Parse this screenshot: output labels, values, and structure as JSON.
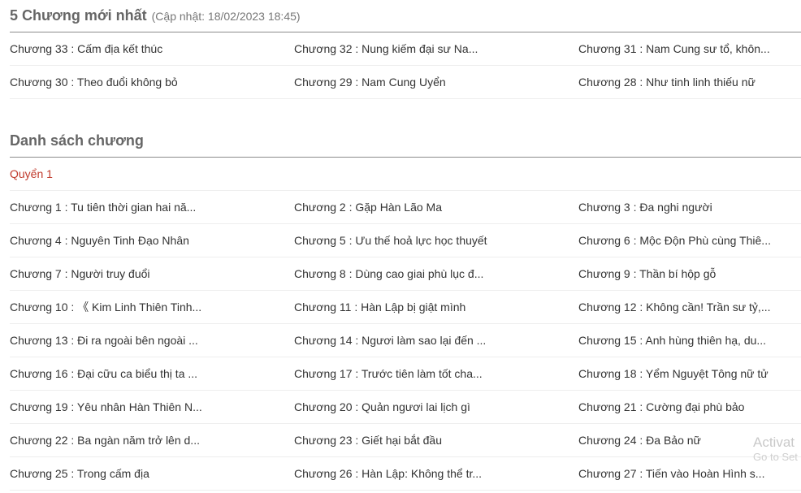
{
  "latest": {
    "title": "5 Chương mới nhất",
    "updated": "(Cập nhật: 18/02/2023 18:45)",
    "rows": [
      [
        "Chương 33 : Cấm địa kết thúc",
        "Chương 32 : Nung kiếm đại sư Na...",
        "Chương 31 : Nam Cung sư tổ, khôn..."
      ],
      [
        "Chương 30 : Theo đuổi không bỏ",
        "Chương 29 : Nam Cung Uyển",
        "Chương 28 : Như tinh linh thiếu nữ"
      ]
    ]
  },
  "list": {
    "title": "Danh sách chương",
    "volume": "Quyển 1",
    "rows": [
      [
        "Chương 1 : Tu tiên thời gian hai nă...",
        "Chương 2 : Gặp Hàn Lão Ma",
        "Chương 3 : Đa nghi người"
      ],
      [
        "Chương 4 : Nguyên Tinh Đạo Nhân",
        "Chương 5 : Ưu thế hoả lực học thuyết",
        "Chương 6 : Mộc Độn Phù cùng Thiê..."
      ],
      [
        "Chương 7 : Người truy đuổi",
        "Chương 8 : Dùng cao giai phù lục đ...",
        "Chương 9 : Thần bí hộp gỗ"
      ],
      [
        "Chương 10 : 《 Kim Linh Thiên Tinh...",
        "Chương 11 : Hàn Lập bị giật mình",
        "Chương 12 : Không cần! Trần sư tỷ,..."
      ],
      [
        "Chương 13 : Đi ra ngoài bên ngoài ...",
        "Chương 14 : Ngươi làm sao lại đến ...",
        "Chương 15 : Anh hùng thiên hạ, du..."
      ],
      [
        "Chương 16 : Đại cữu ca biểu thị ta ...",
        "Chương 17 : Trước tiên làm tốt cha...",
        "Chương 18 : Yểm Nguyệt Tông nữ tử"
      ],
      [
        "Chương 19 : Yêu nhân Hàn Thiên N...",
        "Chương 20 : Quản ngươi lai lịch gì",
        "Chương 21 : Cường đại phù bảo"
      ],
      [
        "Chương 22 : Ba ngàn năm trở lên d...",
        "Chương 23 : Giết hại bắt đầu",
        "Chương 24 : Đa Bảo nữ"
      ],
      [
        "Chương 25 : Trong cấm địa",
        "Chương 26 : Hàn Lập: Không thể tr...",
        "Chương 27 : Tiến vào Hoàn Hình s..."
      ]
    ]
  },
  "watermark": {
    "line1": "Activat",
    "line2": "Go to Set"
  }
}
